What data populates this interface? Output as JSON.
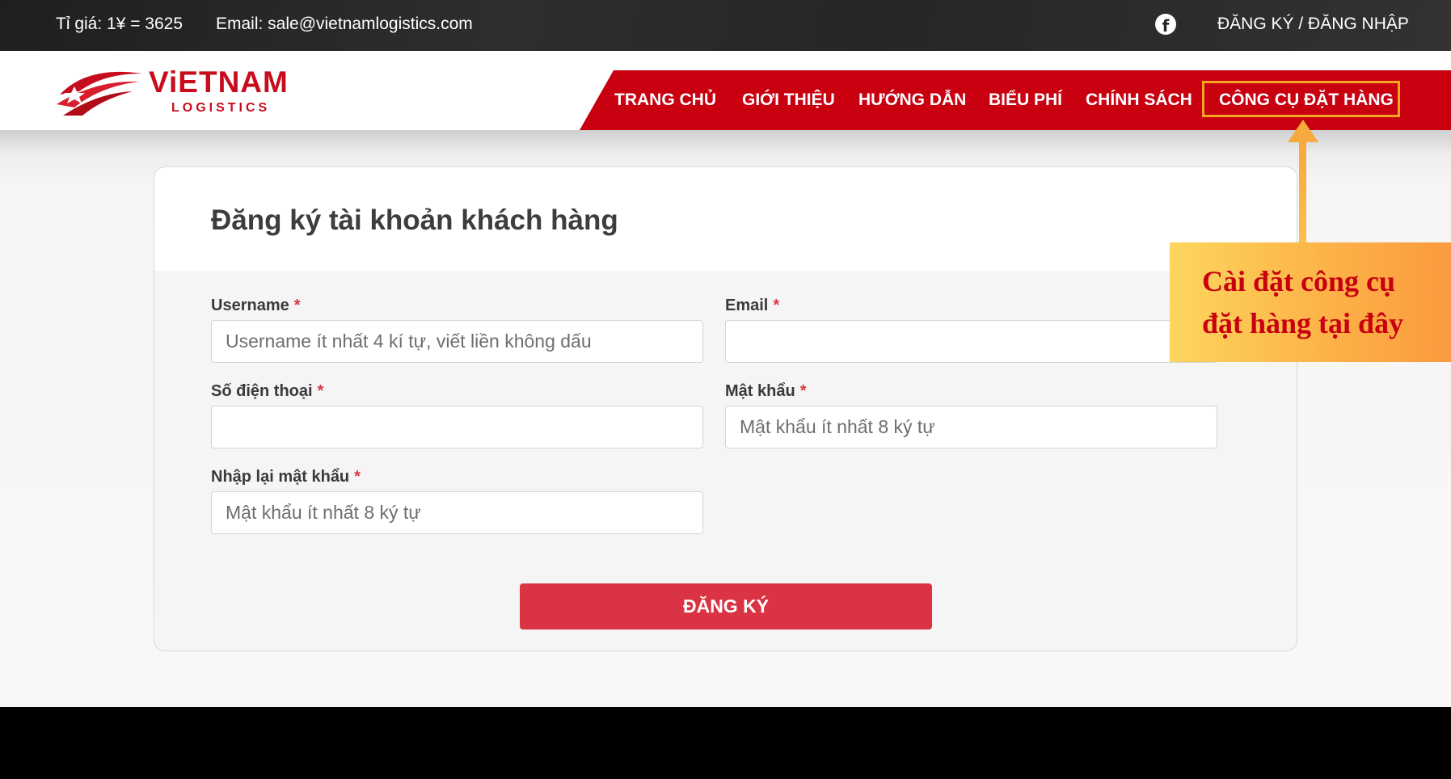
{
  "topbar": {
    "exchange_rate": "Tỉ giá: 1¥ = 3625",
    "email": "Email: sale@vietnamlogistics.com",
    "facebook_glyph": "f",
    "auth_link": "ĐĂNG KÝ / ĐĂNG NHẬP"
  },
  "logo": {
    "title": "ViETNAM",
    "subtitle": "LOGISTICS"
  },
  "nav": {
    "items": [
      "TRANG CHỦ",
      "GIỚI THIỆU",
      "HƯỚNG DẪN",
      "BIỂU PHÍ",
      "CHÍNH SÁCH",
      "CÔNG CỤ ĐẶT HÀNG"
    ]
  },
  "form": {
    "title": "Đăng ký tài khoản khách hàng",
    "required_mark": "*",
    "fields": {
      "username": {
        "label": "Username",
        "placeholder": "Username ít nhất 4 kí tự, viết liền không dấu",
        "value": ""
      },
      "email": {
        "label": "Email",
        "placeholder": "",
        "value": ""
      },
      "phone": {
        "label": "Số điện thoại",
        "placeholder": "",
        "value": ""
      },
      "password": {
        "label": "Mật khẩu",
        "placeholder": "Mật khẩu ít nhất 8 ký tự",
        "value": ""
      },
      "confirm_password": {
        "label": "Nhập lại mật khẩu",
        "placeholder": "Mật khẩu ít nhất 8 ký tự",
        "value": ""
      }
    },
    "submit_label": "ĐĂNG KÝ"
  },
  "annotation": {
    "line1": "Cài đặt công cụ",
    "line2": "đặt hàng tại đây"
  },
  "colors": {
    "brand_red": "#c8000f",
    "button_red": "#da3343",
    "highlight_orange": "#f6a623",
    "topbar_dark": "#262626"
  }
}
